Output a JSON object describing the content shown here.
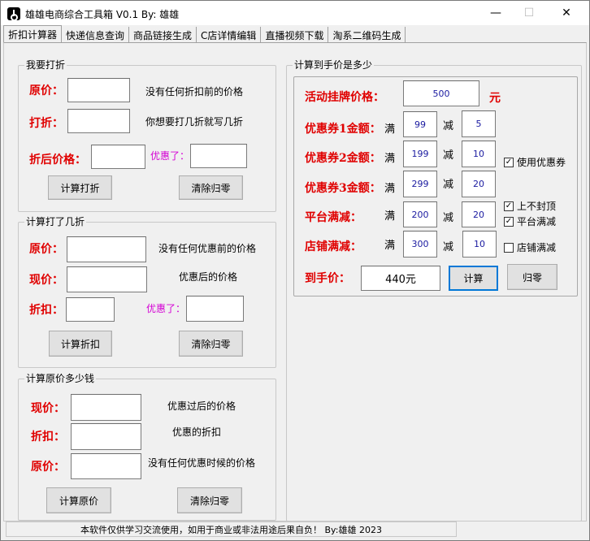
{
  "window": {
    "title": "雄雄电商综合工具箱 V0.1    By: 雄雄",
    "minimize": "—",
    "maximize": "☐",
    "close": "✕"
  },
  "tabs": [
    "折扣计算器",
    "快递信息查询",
    "商品链接生成",
    "C店详情编辑",
    "直播视频下载",
    "淘系二维码生成"
  ],
  "discount": {
    "group_title": "我要打折",
    "price_label": "原价：",
    "price_hint": "没有任何折扣前的价格",
    "rate_label": "打折：",
    "rate_hint": "你想要打几折就写几折",
    "after_label": "折后价格：",
    "saved_label": "优惠了：",
    "calc_button": "计算打折",
    "clear_button": "清除归零"
  },
  "rate": {
    "group_title": "计算打了几折",
    "orig_label": "原价：",
    "orig_hint": "没有任何优惠前的价格",
    "now_label": "现价：",
    "now_hint": "优惠后的价格",
    "rate_label": "折扣：",
    "saved_label": "优惠了：",
    "calc_button": "计算折扣",
    "clear_button": "清除归零"
  },
  "original": {
    "group_title": "计算原价多少钱",
    "now_label": "现价：",
    "now_hint": "优惠过后的价格",
    "rate_label": "折扣：",
    "rate_hint": "优惠的折扣",
    "orig_label": "原价：",
    "orig_hint": "没有任何优惠时候的价格",
    "calc_button": "计算原价",
    "clear_button": "清除归零"
  },
  "final": {
    "group_title": "计算到手价是多少",
    "list_label": "活动挂牌价格：",
    "list_value": "500",
    "unit": "元",
    "coupon1_label": "优惠券1金额：",
    "coupon1_full": "99",
    "coupon1_minus": "5",
    "coupon2_label": "优惠券2金额：",
    "coupon2_full": "199",
    "coupon2_minus": "10",
    "coupon3_label": "优惠券3金额：",
    "coupon3_full": "299",
    "coupon3_minus": "20",
    "platform_label": "平台满减：",
    "platform_full": "200",
    "platform_minus": "20",
    "shop_label": "店铺满减：",
    "shop_full": "300",
    "shop_minus": "10",
    "man": "满",
    "jian": "减",
    "use_coupon": "使用优惠券",
    "no_cap": "上不封顶",
    "platform_check": "平台满减",
    "shop_check": "店铺满减",
    "check_mark": "✓",
    "final_label": "到手价：",
    "final_value": "440元",
    "calc_button": "计算",
    "clear_button": "归零"
  },
  "status": {
    "text": "本软件仅供学习交流使用，如用于商业或非法用途后果自负！  By:雄雄   2023"
  }
}
